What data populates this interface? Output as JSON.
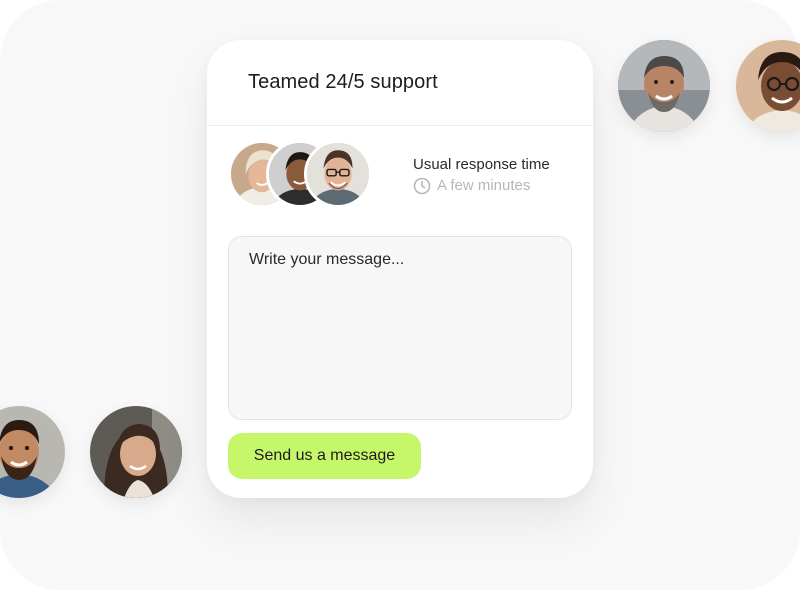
{
  "widget": {
    "title": "Teamed 24/5 support",
    "response_label": "Usual response time",
    "response_value": "A few minutes",
    "message_placeholder": "Write your message...",
    "send_label": "Send us a message"
  },
  "team_avatars": [
    {
      "name": "avatar-blonde-woman",
      "bg": "#c8a88a",
      "skin": "#e3b797",
      "hair": "#e8dcc4"
    },
    {
      "name": "avatar-smiling-man",
      "bg": "#cfcfcf",
      "skin": "#8a5a3b",
      "hair": "#1e1712"
    },
    {
      "name": "avatar-glasses-man",
      "bg": "#e4e1dc",
      "skin": "#e2b396",
      "hair": "#4a3426"
    }
  ],
  "floating_avatars": [
    {
      "name": "avatar-gray-beard-man"
    },
    {
      "name": "avatar-glasses-woman"
    },
    {
      "name": "avatar-bearded-man"
    },
    {
      "name": "avatar-long-hair-woman"
    }
  ],
  "colors": {
    "accent": "#c6f76a",
    "muted_text": "#b7b7b7",
    "backdrop": "#f8f8f8"
  }
}
